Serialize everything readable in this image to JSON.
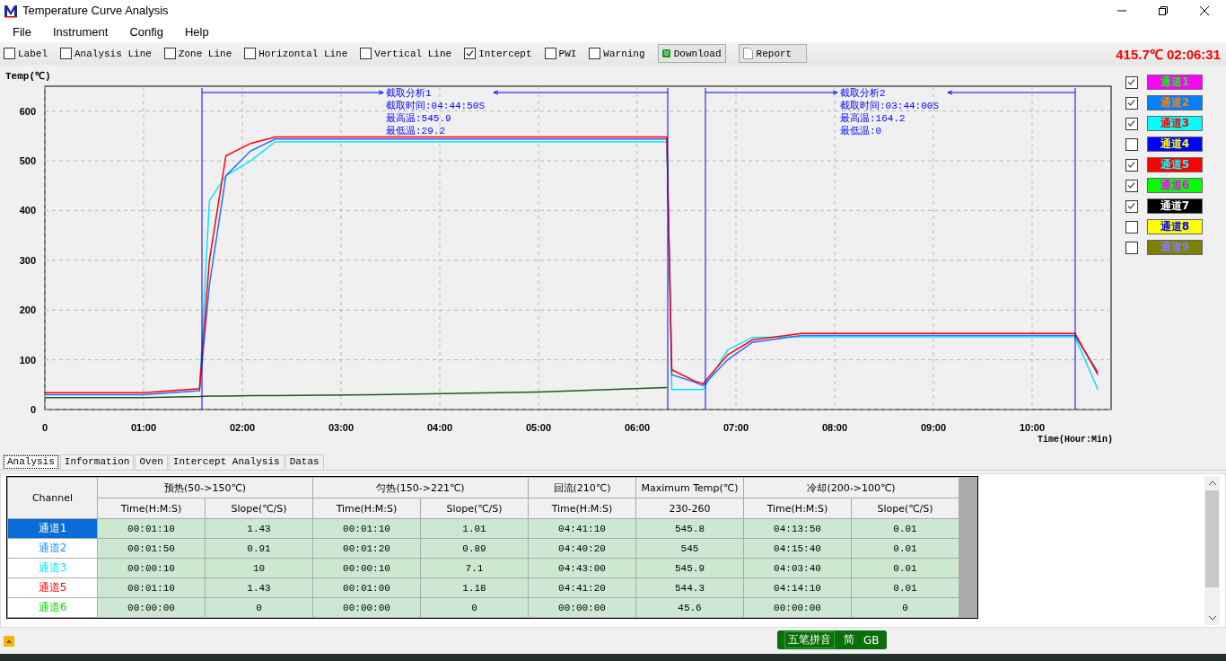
{
  "window": {
    "title": "Temperature Curve Analysis"
  },
  "menu": [
    "File",
    "Instrument",
    "Config",
    "Help"
  ],
  "toolbar": {
    "options": [
      {
        "label": "Label",
        "checked": false
      },
      {
        "label": "Analysis Line",
        "checked": false
      },
      {
        "label": "Zone Line",
        "checked": false
      },
      {
        "label": "Horizontal Line",
        "checked": false
      },
      {
        "label": "Vertical Line",
        "checked": false
      },
      {
        "label": "Intercept",
        "checked": true
      },
      {
        "label": "PWI",
        "checked": false
      },
      {
        "label": "Warning",
        "checked": false
      }
    ],
    "buttons": [
      {
        "kind": "download",
        "label": "Download"
      },
      {
        "kind": "report",
        "label": "Report"
      }
    ],
    "reading": "415.7℃ 02:06:31"
  },
  "chart": {
    "chart_data": {
      "type": "line",
      "xlabel": "Time(Hour:Min)",
      "ylabel": "Temp(℃)",
      "xlim": [
        0,
        648
      ],
      "ylim": [
        0,
        650
      ],
      "grid": true,
      "xticks": [
        {
          "value": 0,
          "label": "0"
        },
        {
          "value": 60,
          "label": "01:00"
        },
        {
          "value": 120,
          "label": "02:00"
        },
        {
          "value": 180,
          "label": "03:00"
        },
        {
          "value": 240,
          "label": "04:00"
        },
        {
          "value": 300,
          "label": "05:00"
        },
        {
          "value": 360,
          "label": "06:00"
        },
        {
          "value": 420,
          "label": "07:00"
        },
        {
          "value": 480,
          "label": "08:00"
        },
        {
          "value": 540,
          "label": "09:00"
        },
        {
          "value": 600,
          "label": "10:00"
        }
      ],
      "yticks": [
        0,
        100,
        200,
        300,
        400,
        500,
        600
      ],
      "x": [
        0,
        60,
        94,
        100,
        110,
        125,
        140,
        200,
        300,
        378,
        381,
        395,
        400,
        415,
        430,
        460,
        540,
        626,
        640
      ],
      "series": [
        {
          "color": "#1e5a1e",
          "values": [
            24,
            24,
            26,
            27,
            27,
            28,
            28,
            30,
            35,
            44,
            null,
            null,
            null,
            null,
            null,
            null,
            null,
            null,
            null
          ]
        },
        {
          "color": "#00e5ff",
          "values": [
            null,
            null,
            40,
            420,
            470,
            500,
            538,
            538,
            538,
            538,
            40,
            40,
            40,
            120,
            145,
            146,
            146,
            146,
            40
          ]
        },
        {
          "color": "#2a6bff",
          "values": [
            30,
            30,
            38,
            250,
            470,
            520,
            544,
            544,
            544,
            544,
            70,
            55,
            48,
            100,
            135,
            149,
            149,
            149,
            75
          ]
        },
        {
          "color": "#ff0000",
          "values": [
            34,
            34,
            42,
            300,
            510,
            535,
            548,
            548,
            548,
            548,
            80,
            57,
            52,
            110,
            140,
            153,
            153,
            153,
            70
          ]
        }
      ]
    },
    "intercepts": [
      {
        "lines": [
          "截取分析1",
          "截取时间:04:44:50S",
          "最高温:545.9",
          "最低温:29.2"
        ]
      },
      {
        "lines": [
          "截取分析2",
          "截取时间:03:44:00S",
          "最高温:164.2",
          "最低温:0"
        ]
      }
    ]
  },
  "legend": [
    {
      "label": "通道1",
      "checked": true,
      "color": "#ff00ff"
    },
    {
      "label": "通道2",
      "checked": true,
      "color": "#0080ff"
    },
    {
      "label": "通道3",
      "checked": true,
      "color": "#00ffff"
    },
    {
      "label": "通道4",
      "checked": false,
      "color": "#0000ff"
    },
    {
      "label": "通道5",
      "checked": true,
      "color": "#ff0000"
    },
    {
      "label": "通道6",
      "checked": true,
      "color": "#00ff00"
    },
    {
      "label": "通道7",
      "checked": true,
      "color": "#000000"
    },
    {
      "label": "通道8",
      "checked": false,
      "color": "#ffff00"
    },
    {
      "label": "通道9",
      "checked": false,
      "color": "#808000"
    }
  ],
  "tabs": [
    {
      "label": "Analysis",
      "selected": true
    },
    {
      "label": "Information",
      "selected": false
    },
    {
      "label": "Oven",
      "selected": false
    },
    {
      "label": "Intercept Analysis",
      "selected": false
    },
    {
      "label": "Datas",
      "selected": false
    }
  ],
  "table": {
    "channel_header": "Channel",
    "groups": [
      {
        "label": "预热(50->150℃)",
        "sub": [
          "Time(H:M:S)",
          "Slope(℃/S)"
        ]
      },
      {
        "label": "匀热(150->221℃)",
        "sub": [
          "Time(H:M:S)",
          "Slope(℃/S)"
        ]
      },
      {
        "label": "回流(210℃)",
        "sub": [
          "Time(H:M:S)"
        ]
      },
      {
        "label": "Maximum Temp(℃)",
        "sub": [
          "230-260"
        ]
      },
      {
        "label": "冷却(200->100℃)",
        "sub": [
          "Time(H:M:S)",
          "Slope(℃/S)"
        ]
      }
    ],
    "rows": [
      {
        "channel": "通道1",
        "color": "#0a6cd6",
        "selected": true,
        "cells": [
          "00:01:10",
          "1.43",
          "00:01:10",
          "1.01",
          "04:41:10",
          "545.8",
          "04:13:50",
          "0.01"
        ]
      },
      {
        "channel": "通道2",
        "color": "#1e90ff",
        "selected": false,
        "cells": [
          "00:01:50",
          "0.91",
          "00:01:20",
          "0.89",
          "04:40:20",
          "545",
          "04:15:40",
          "0.01"
        ]
      },
      {
        "channel": "通道3",
        "color": "#00e5ff",
        "selected": false,
        "cells": [
          "00:00:10",
          "10",
          "00:00:10",
          "7.1",
          "04:43:00",
          "545.9",
          "04:03:40",
          "0.01"
        ]
      },
      {
        "channel": "通道5",
        "color": "#ff0000",
        "selected": false,
        "cells": [
          "00:01:10",
          "1.43",
          "00:01:00",
          "1.18",
          "04:41:20",
          "544.3",
          "04:14:10",
          "0.01"
        ]
      },
      {
        "channel": "通道6",
        "color": "#00dd00",
        "selected": false,
        "cells": [
          "00:00:00",
          "0",
          "00:00:00",
          "0",
          "00:00:00",
          "45.6",
          "00:00:00",
          "0"
        ]
      }
    ]
  },
  "ime": {
    "mode": "五笔拼音",
    "script": "简",
    "charset": "GB"
  }
}
